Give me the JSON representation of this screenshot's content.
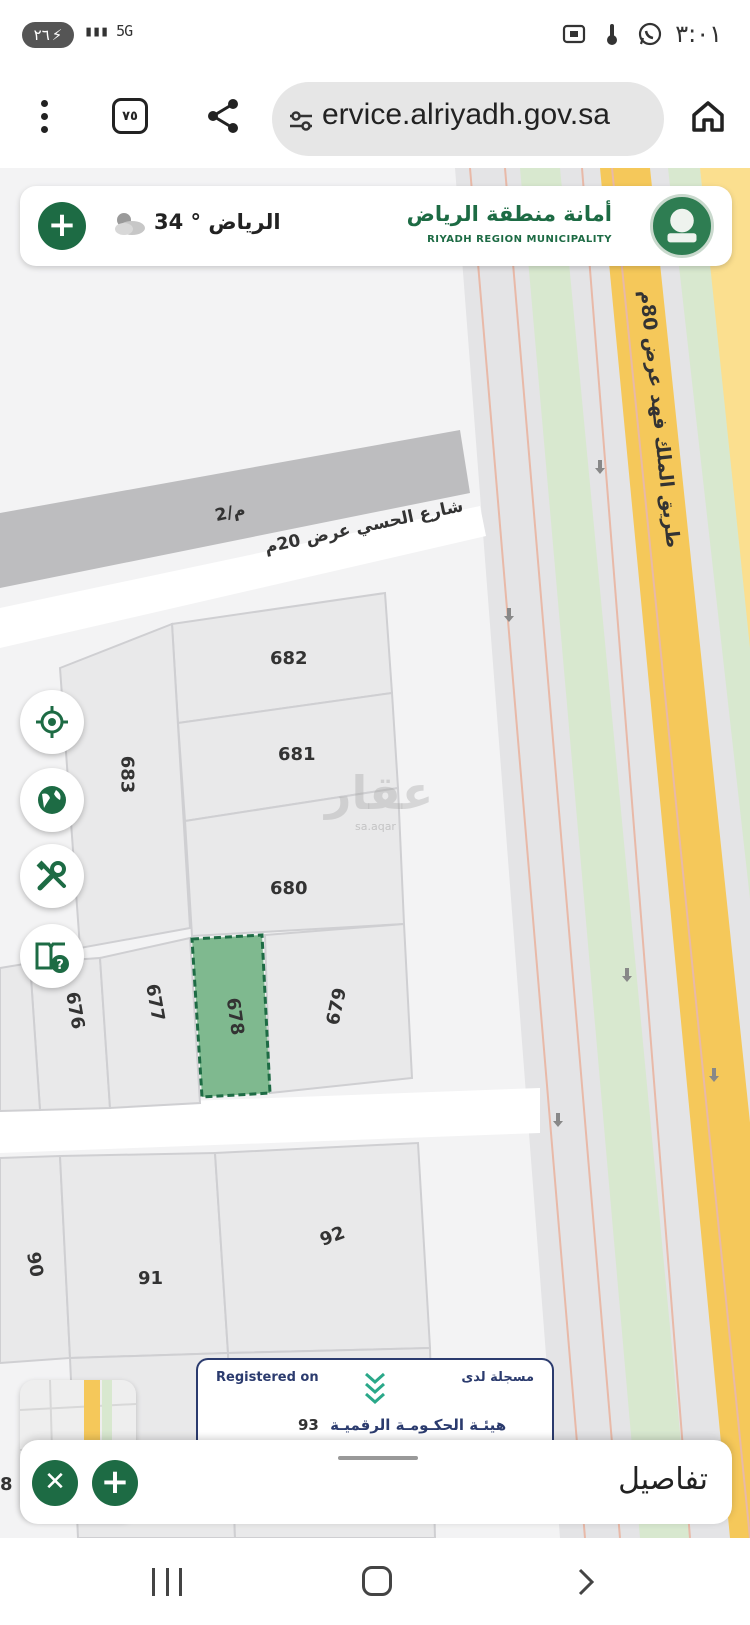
{
  "status_bar": {
    "time": "٣:٠١",
    "battery": "٢٦",
    "network": "5G"
  },
  "browser": {
    "url": "ervice.alriyadh.gov.sa",
    "tab_count": "٧٥"
  },
  "header": {
    "org_name_ar": "أمانة منطقة الرياض",
    "org_name_en": "RIYADH REGION MUNICIPALITY",
    "weather": "الرياض ° 34",
    "weather_icon": "partly-cloudy-icon"
  },
  "map": {
    "roads": {
      "king_fahd": "طريق الملك فهد عرض 80م",
      "alhasi": "شارع الحسي عرض 20م",
      "alley": "م/2"
    },
    "parcels": [
      "682",
      "681",
      "683",
      "680",
      "676",
      "677",
      "678",
      "679",
      "90",
      "91",
      "92",
      "93",
      "8"
    ],
    "selected_parcel": "678",
    "watermark": "عقار",
    "watermark_sub": "sa.aqar"
  },
  "registered_badge": {
    "label_en": "Registered on",
    "label_ar": "مسجلة لدى",
    "authority": "هيئـة الحكـومـة الرقميـة"
  },
  "details_sheet": {
    "title": "تفاصيل"
  },
  "colors": {
    "brand_green": "#1d6b44",
    "highway_yellow": "#f5c85a",
    "selected_fill": "#7fb98f"
  }
}
